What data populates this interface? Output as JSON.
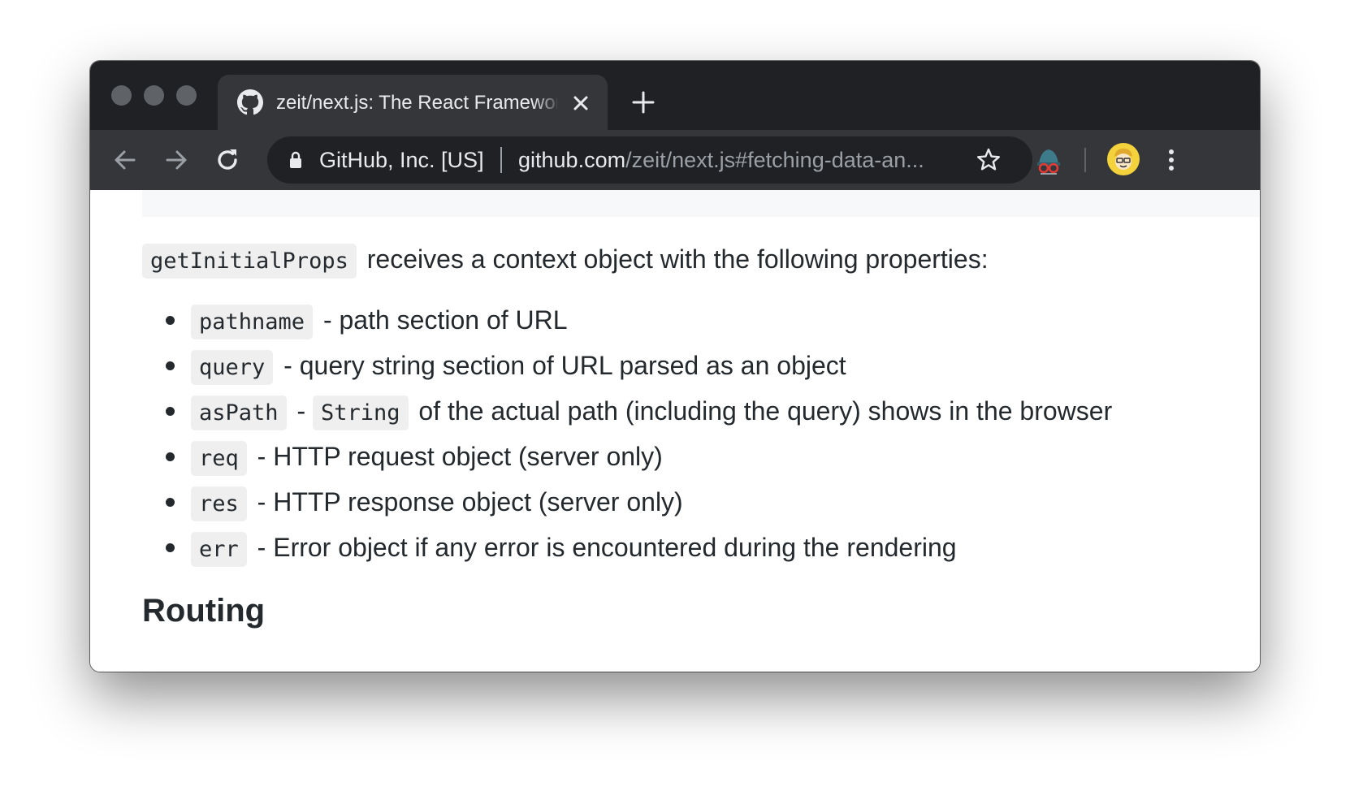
{
  "browser": {
    "tab": {
      "title": "zeit/next.js: The React Framework",
      "favicon": "github-icon"
    },
    "new_tab_icon": "plus-icon",
    "nav": {
      "back_icon": "arrow-left-icon",
      "forward_icon": "arrow-right-icon",
      "reload_icon": "reload-icon"
    },
    "address": {
      "origin_label": "GitHub, Inc. [US]",
      "host": "github.com",
      "path": "/zeit/next.js#fetching-data-an...",
      "lock_icon": "lock-icon",
      "bookmark_icon": "star-icon"
    },
    "extensions": [
      "incognito-extension-icon"
    ],
    "profile_icon": "avatar-icon",
    "menu_icon": "kebab-menu-icon"
  },
  "content": {
    "intro_code": "getInitialProps",
    "intro_text": "receives a context object with the following properties:",
    "properties": [
      {
        "code": "pathname",
        "text": "- path section of URL"
      },
      {
        "code": "query",
        "text": "- query string section of URL parsed as an object"
      },
      {
        "code": "asPath",
        "text": "-",
        "code2": "String",
        "text2": "of the actual path (including the query) shows in the browser"
      },
      {
        "code": "req",
        "text": "- HTTP request object (server only)"
      },
      {
        "code": "res",
        "text": "- HTTP response object (server only)"
      },
      {
        "code": "err",
        "text": "- Error object if any error is encountered during the rendering"
      }
    ],
    "next_heading": "Routing"
  },
  "colors": {
    "tabbar": "#202124",
    "toolbar": "#35363a",
    "text": "#24292e",
    "code_bg": "#eff0f1"
  }
}
